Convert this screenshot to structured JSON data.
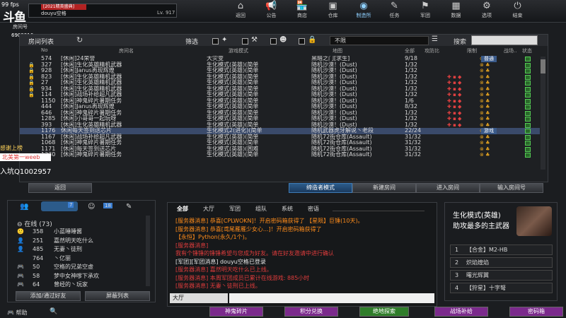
{
  "fps": "99 fps",
  "logo": "斗鱼",
  "user": {
    "tag": "[2021精英盛典]",
    "name": "douyu空格",
    "level": "Lv. 917",
    "id": "6909916",
    "room_label": "房间号"
  },
  "nav": [
    {
      "label": "返回",
      "icon": "return-icon",
      "glyph": "⌂"
    },
    {
      "label": "公告",
      "icon": "announcement-icon",
      "glyph": "📢"
    },
    {
      "label": "商店",
      "icon": "shop-icon",
      "glyph": "🏪"
    },
    {
      "label": "仓库",
      "icon": "warehouse-icon",
      "glyph": "▣"
    },
    {
      "label": "制造所",
      "icon": "factory-icon",
      "glyph": "◉"
    },
    {
      "label": "任务",
      "icon": "mission-icon",
      "glyph": "✎"
    },
    {
      "label": "军团",
      "icon": "clan-icon",
      "glyph": "⚑"
    },
    {
      "label": "数据",
      "icon": "data-icon",
      "glyph": "▦"
    },
    {
      "label": "选项",
      "icon": "settings-icon",
      "glyph": "⚙"
    },
    {
      "label": "结束",
      "icon": "power-icon",
      "glyph": "⏻"
    }
  ],
  "lobby": {
    "title": "房间列表",
    "filter_label": "筛选",
    "filter_value": "不限",
    "search_label": "搜索",
    "columns": {
      "no": "No",
      "name": "房间名",
      "mode": "游戏模式",
      "map": "地图",
      "people": "全部",
      "status": "攻防比",
      "equip": "限制",
      "clan": "战场..",
      "state": "状态"
    },
    "rows": [
      {
        "no": "574",
        "lock": "",
        "name": "[休闲]24荣誉",
        "mode": "大灾变",
        "map": "黑暗之门[求生]",
        "people": "9/18",
        "badge": "普通"
      },
      {
        "no": "327",
        "lock": "🔒",
        "name": "[休闲]生化英雄精机武器",
        "mode": "生化模式(英雄)(简单",
        "map": "随机沙漠！(Dust)",
        "people": "1/32",
        "badge": ""
      },
      {
        "no": "928",
        "lock": "🔒",
        "name": "[休闲]Janus再现辉煌",
        "mode": "生化模式(英雄)(简单",
        "map": "随机沙漠！(Dust)",
        "people": "1/32",
        "badge": ""
      },
      {
        "no": "823",
        "lock": "🔒",
        "name": "[休闲]生化英雄精机武器",
        "mode": "生化模式(英雄)(简单",
        "map": "随机沙漠！(Dust)",
        "people": "1/32",
        "badge": ""
      },
      {
        "no": "27",
        "lock": "🔒",
        "name": "[休闲]生化英雄精机武器",
        "mode": "生化模式(英雄)(简单",
        "map": "随机沙漠！(Dust)",
        "people": "1/32",
        "badge": ""
      },
      {
        "no": "934",
        "lock": "🔒",
        "name": "[休闲]生化英雄精机武器",
        "mode": "生化模式(英雄)(简单",
        "map": "随机沙漠！(Dust)",
        "people": "1/32",
        "badge": ""
      },
      {
        "no": "114",
        "lock": "🔒",
        "name": "[休闲]战场补给超凡武器",
        "mode": "生化模式(英雄)(简单",
        "map": "随机沙漠！(Dust)",
        "people": "1/32",
        "badge": ""
      },
      {
        "no": "1150",
        "lock": "",
        "name": "[休闲]神鬼碎片暑期任务",
        "mode": "生化模式(英雄)(简单",
        "map": "随机沙漠！(Dust)",
        "people": "1/6",
        "badge": ""
      },
      {
        "no": "444",
        "lock": "",
        "name": "[休闲]Janus再现辉煌",
        "mode": "生化模式(英雄)(简单",
        "map": "随机沙漠！(Dust)",
        "people": "8/32",
        "badge": ""
      },
      {
        "no": "646",
        "lock": "",
        "name": "[休闲]神鬼碎片暑期任务",
        "mode": "生化模式(英雄)(简单",
        "map": "随机沙漠！(Dust)",
        "people": "1/32",
        "badge": ""
      },
      {
        "no": "1285",
        "lock": "",
        "name": "[休闲]小哥哥一起玩呀",
        "mode": "生化模式(英雄)(简单",
        "map": "随机沙漠！(Dust)",
        "people": "1/32",
        "badge": ""
      },
      {
        "no": "393",
        "lock": "",
        "name": "[休闲]生化英雄精机武器",
        "mode": "生化模式(英雄)(简单",
        "map": "随机沙漠！(Dust)",
        "people": "1/32",
        "badge": ""
      },
      {
        "no": "1176",
        "lock": "",
        "name": "休闲每天签到送芯片",
        "mode": "生化模式2(进化)(简单",
        "map": "随机武器虎牙解说丶老段",
        "people": "22/24",
        "badge": "游戏"
      },
      {
        "no": "1167",
        "lock": "",
        "name": "[休闲]战场补给超凡武器",
        "mode": "生化模式(英雄)(简单",
        "map": "随机72街仓库(Assault)",
        "people": "31/32",
        "badge": ""
      },
      {
        "no": "1068",
        "lock": "",
        "name": "[休闲]神鬼碎片暑期任务",
        "mode": "生化模式(英雄)(简单",
        "map": "随机72街仓库(Assault)",
        "people": "31/32",
        "badge": ""
      },
      {
        "no": "1171",
        "lock": "",
        "name": "[休闲]每天签到送芯片",
        "mode": "生化模式(英雄)(困难",
        "map": "随机72街仓库(Assault)",
        "people": "31/32",
        "badge": ""
      },
      {
        "no": "1230",
        "lock": "",
        "name": "[休闲]神鬼碎片暑期任务",
        "mode": "生化模式(英雄)(简单",
        "map": "随机72街仓库(Assault)",
        "people": "31/32",
        "badge": ""
      }
    ],
    "back": "返回",
    "spectator": "缔造者模式",
    "new_room": "新建房间",
    "enter_room": "进入房间",
    "input_room": "输入房间号"
  },
  "friends": {
    "tab_count": "7",
    "tab2_count": "18",
    "online_label": "在线 (73)",
    "list": [
      {
        "lv": "358",
        "name": "小蓝睡睡酱"
      },
      {
        "lv": "251",
        "name": "嘉然明天吃什么"
      },
      {
        "lv": "485",
        "name": "无妻丶徒刑"
      },
      {
        "lv": "764",
        "name": "丶亿丽"
      },
      {
        "lv": "50",
        "name": "空格的兄弟空虚"
      },
      {
        "lv": "58",
        "name": "梦中女神嗲下承欢"
      },
      {
        "lv": "64",
        "name": "曾经的丶玩家"
      }
    ],
    "add": "添加/通过好友",
    "block": "屏蔽列表"
  },
  "chat": {
    "tabs": [
      "全部",
      "大厅",
      "军团",
      "组队",
      "系统",
      "密语"
    ],
    "lines": [
      {
        "t": "[服务器消息] 恭喜[CPLWOKN]！开启密码箱获得了 【星陨】巨锤(10天)。",
        "c": "#ff8c1a"
      },
      {
        "t": "[服务器消息] 恭喜[鸢尾雁雁少女心...]！开启密码箱获得了",
        "c": "#ff8c1a"
      },
      {
        "t": "【永恒】Python(永久/1个)。",
        "c": "#ff8c1a"
      },
      {
        "t": "[服务器消息]",
        "c": "#e03c3c"
      },
      {
        "t": "我有个锤锤的锤锤希望与您成为好友。请在好友邀请中进行确认",
        "c": "#e03c3c"
      },
      {
        "t": "[军团][军团消息] douyu空格已登录",
        "c": "#e8e8e8"
      },
      {
        "t": "[服务器消息] 嘉然明天吃什么已上线。",
        "c": "#e03c3c"
      },
      {
        "t": "[服务器消息] 本周军团成员已累计在线游戏: 885小时",
        "c": "#e03c3c"
      },
      {
        "t": "[服务器消息] 无妻丶徒刑已上线。",
        "c": "#e03c3c"
      }
    ],
    "channel": "大厅"
  },
  "mode_panel": {
    "title": "生化模式(英雄)",
    "subtitle": "助攻最多的主武器",
    "items": [
      {
        "n": "1",
        "t": "【合金】M2-HB"
      },
      {
        "n": "2",
        "t": "炽焰煌焰"
      },
      {
        "n": "3",
        "t": "曙光辉翼"
      },
      {
        "n": "4",
        "t": "【狩星】十字弩"
      }
    ]
  },
  "streamer": {
    "l1": "感谢上榜",
    "l2": "北美第一weeb",
    "l3": "入坑Q1002957"
  },
  "help": "帮助",
  "bottom_buttons": [
    {
      "t": "神鬼碎片",
      "c": "#7b2a8c"
    },
    {
      "t": "积分兑换",
      "c": "#7b2a8c"
    },
    {
      "t": "绝地探索",
      "c": "#2f7d2a"
    },
    {
      "t": "战场补给",
      "c": "#7b2a8c"
    },
    {
      "t": "密码箱",
      "c": "#7b2a8c"
    }
  ]
}
